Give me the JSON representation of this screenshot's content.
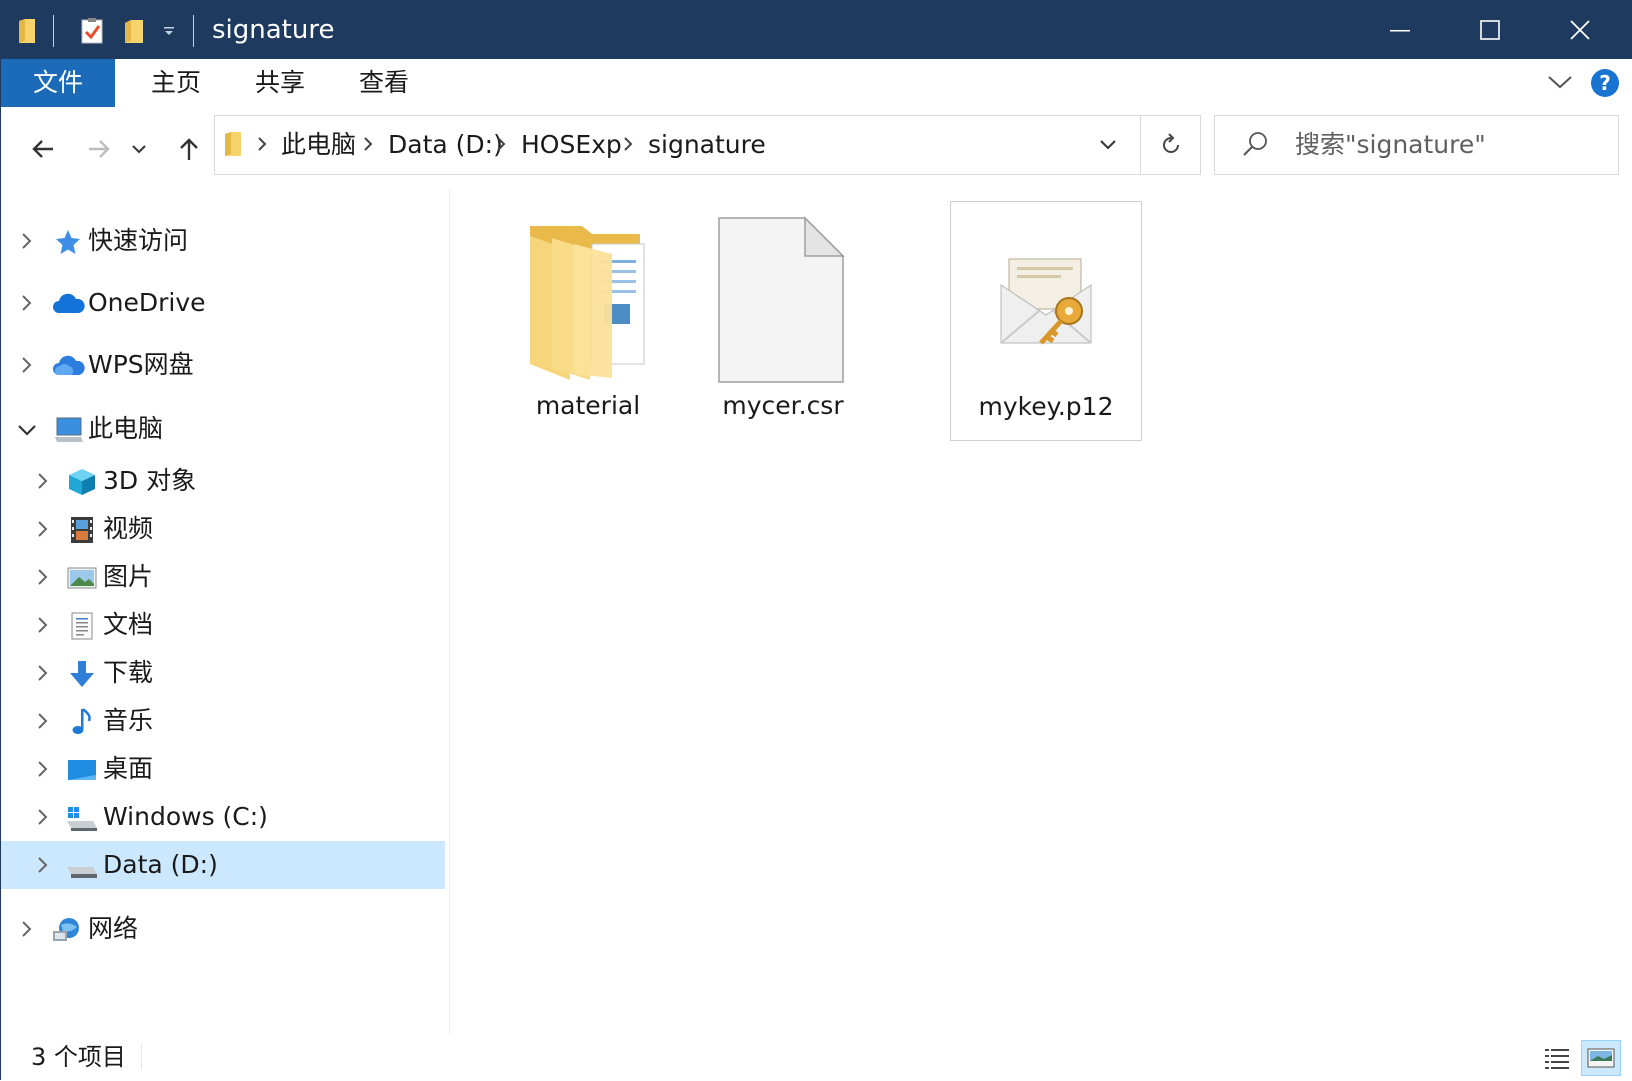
{
  "window": {
    "title": "signature"
  },
  "quick_access_toolbar": {
    "icons": [
      "folder-icon",
      "properties-icon",
      "new-folder-icon",
      "customize-dropdown-icon"
    ]
  },
  "ribbon": {
    "tabs": [
      {
        "label": "文件",
        "active": true
      },
      {
        "label": "主页"
      },
      {
        "label": "共享"
      },
      {
        "label": "查看"
      }
    ],
    "help_label": "?"
  },
  "address_bar": {
    "breadcrumbs": [
      "此电脑",
      "Data (D:)",
      "HOSExp",
      "signature"
    ]
  },
  "search": {
    "placeholder": "搜索\"signature\""
  },
  "nav_tree": {
    "items": [
      {
        "label": "快速访问",
        "icon": "star-icon"
      },
      {
        "label": "OneDrive",
        "icon": "cloud-icon"
      },
      {
        "label": "WPS网盘",
        "icon": "cloud-icon"
      },
      {
        "label": "此电脑",
        "icon": "computer-icon",
        "expanded": true
      },
      {
        "label": "3D 对象",
        "icon": "cube-icon"
      },
      {
        "label": "视频",
        "icon": "film-icon"
      },
      {
        "label": "图片",
        "icon": "picture-icon"
      },
      {
        "label": "文档",
        "icon": "document-icon"
      },
      {
        "label": "下载",
        "icon": "download-arrow-icon"
      },
      {
        "label": "音乐",
        "icon": "music-note-icon"
      },
      {
        "label": "桌面",
        "icon": "desktop-icon"
      },
      {
        "label": "Windows (C:)",
        "icon": "windows-drive-icon"
      },
      {
        "label": "Data (D:)",
        "icon": "drive-icon",
        "selected": true
      },
      {
        "label": "网络",
        "icon": "network-icon"
      }
    ]
  },
  "files": [
    {
      "name": "material",
      "type": "folder"
    },
    {
      "name": "mycer.csr",
      "type": "file"
    },
    {
      "name": "mykey.p12",
      "type": "certificate"
    }
  ],
  "status_bar": {
    "text": "3 个项目"
  },
  "colors": {
    "titlebar": "#1e3a5f",
    "file_tab": "#1c6bb8",
    "selection": "#cce8ff",
    "help": "#1874d0"
  }
}
